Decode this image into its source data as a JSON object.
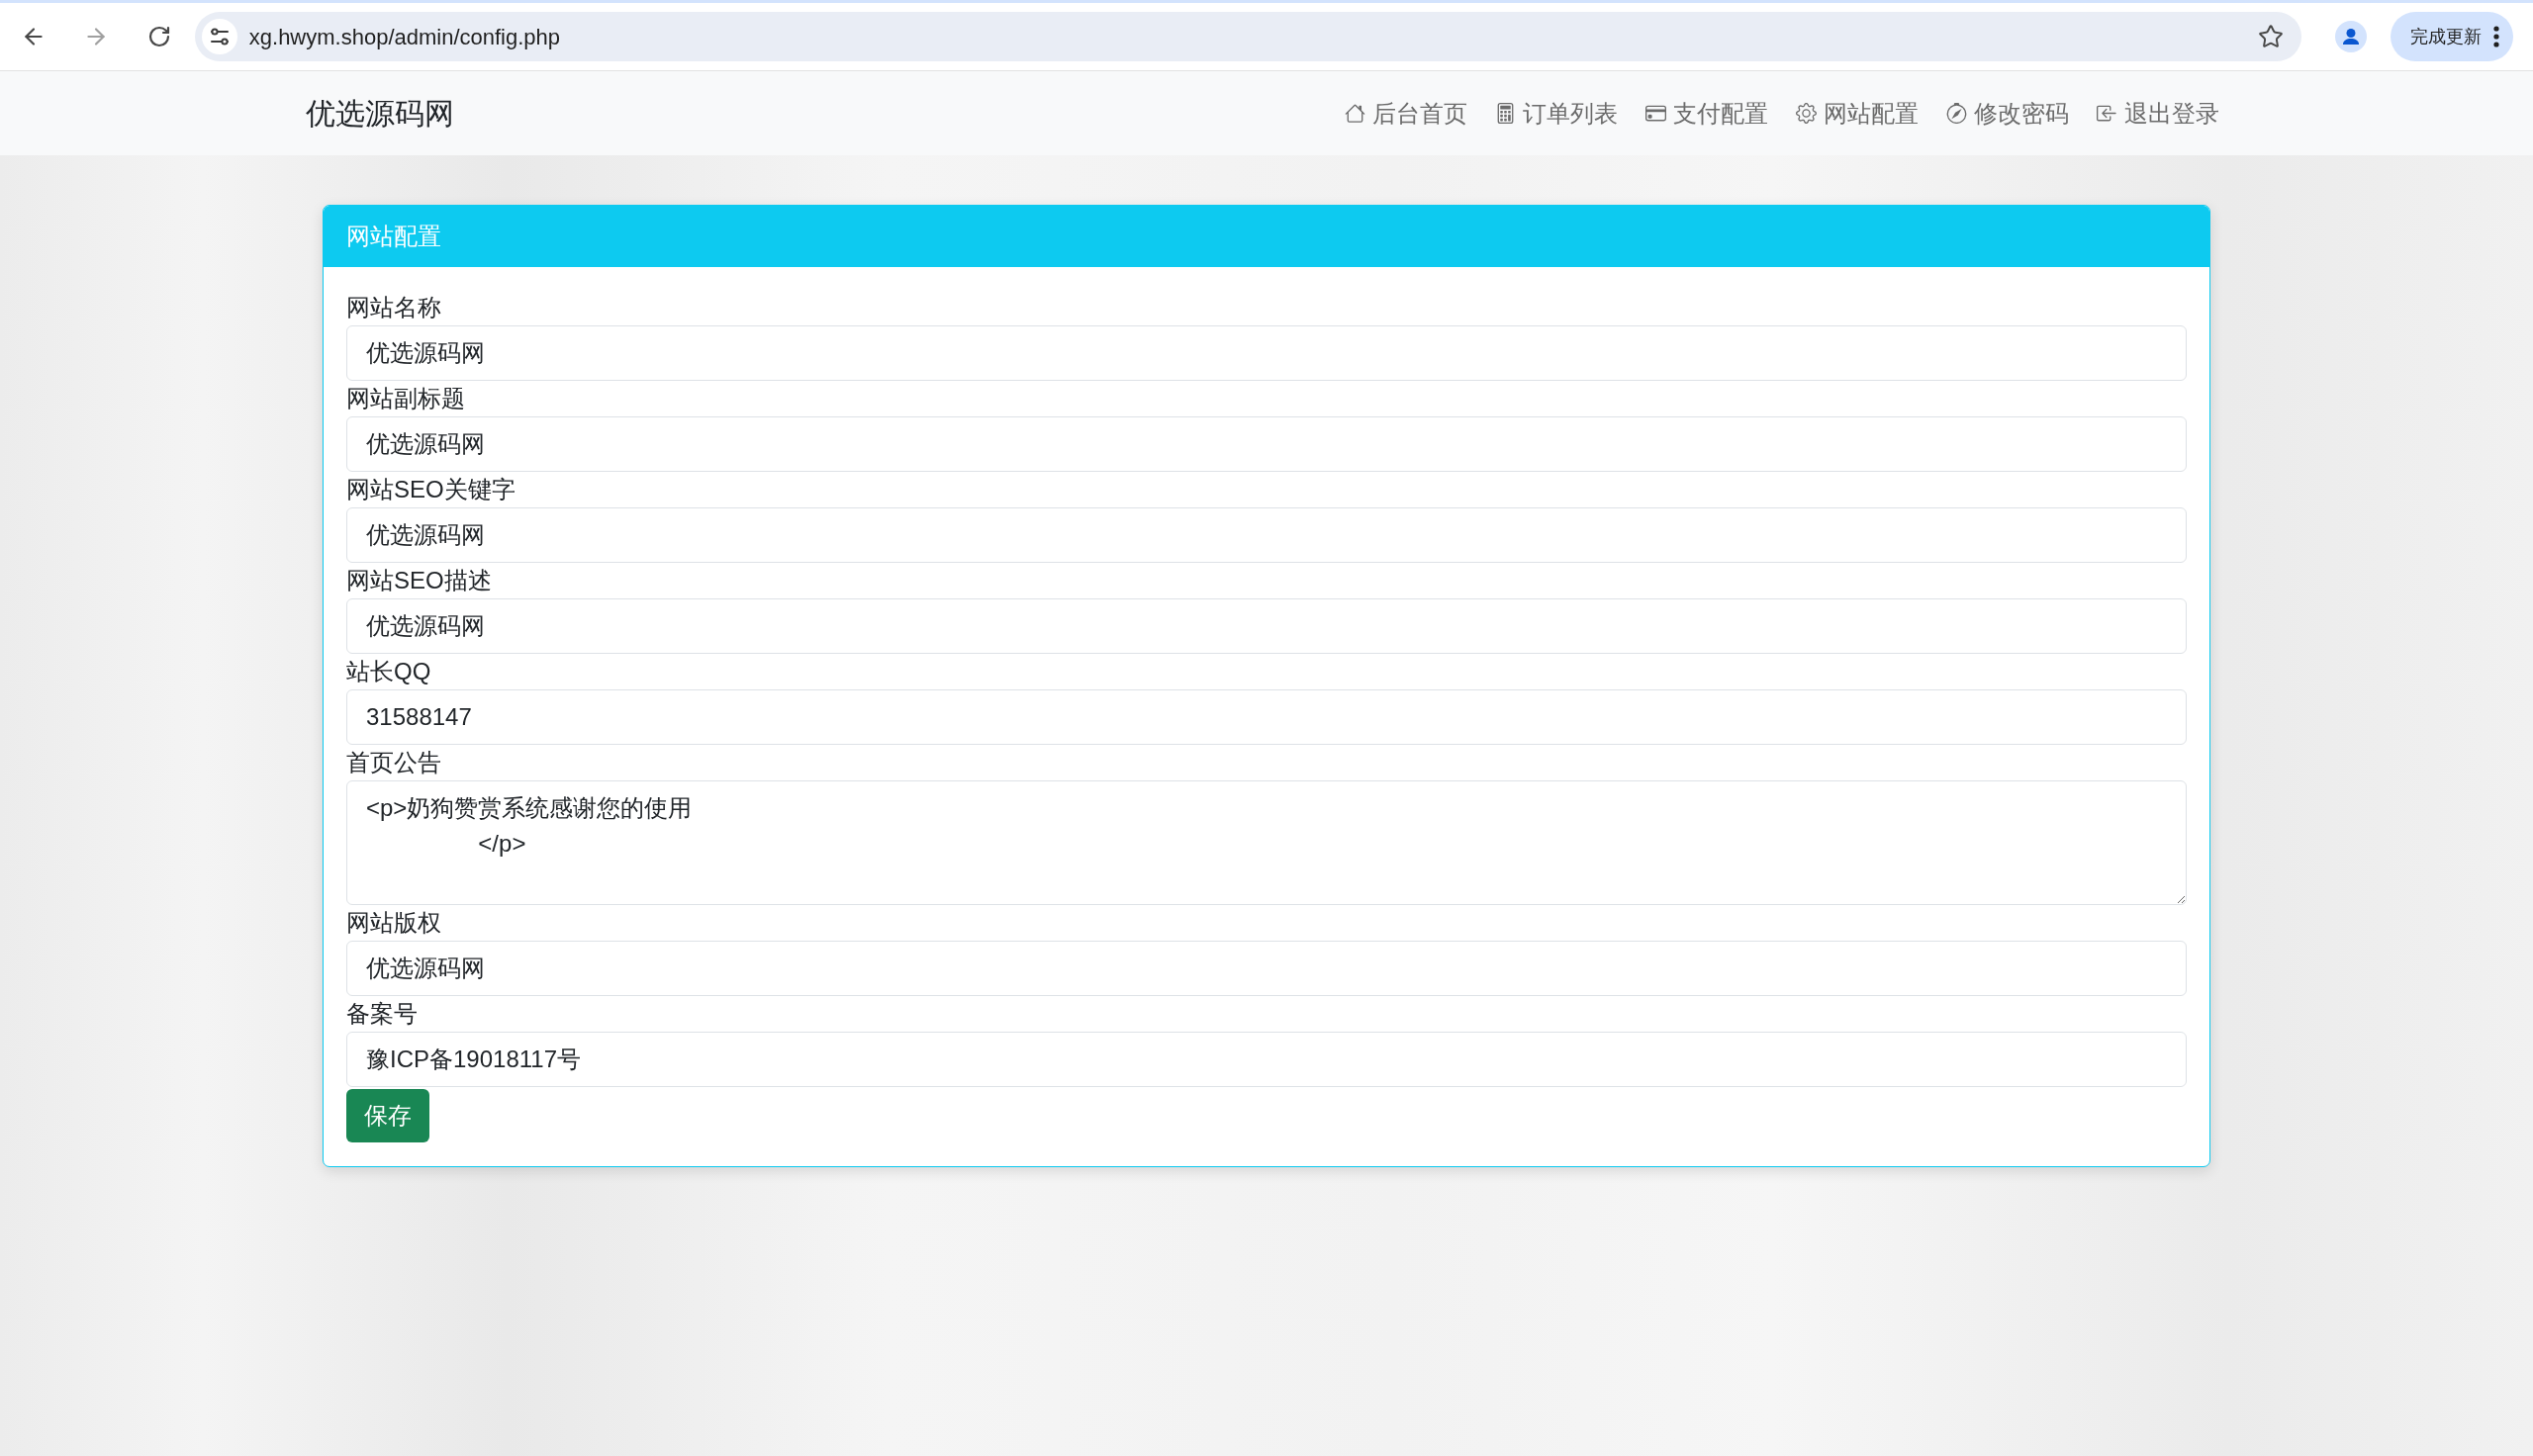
{
  "browser": {
    "url": "xg.hwym.shop/admin/config.php",
    "update_button": "完成更新"
  },
  "navbar": {
    "brand": "优选源码网",
    "items": [
      {
        "label": "后台首页"
      },
      {
        "label": "订单列表"
      },
      {
        "label": "支付配置"
      },
      {
        "label": "网站配置"
      },
      {
        "label": "修改密码"
      },
      {
        "label": "退出登录"
      }
    ]
  },
  "card": {
    "title": "网站配置",
    "fields": [
      {
        "kind": "input",
        "label": "网站名称",
        "value": "优选源码网"
      },
      {
        "kind": "input",
        "label": "网站副标题",
        "value": "优选源码网"
      },
      {
        "kind": "input",
        "label": "网站SEO关键字",
        "value": "优选源码网"
      },
      {
        "kind": "input",
        "label": "网站SEO描述",
        "value": "优选源码网"
      },
      {
        "kind": "input",
        "label": "站长QQ",
        "value": "31588147"
      },
      {
        "kind": "textarea",
        "label": "首页公告",
        "value": "<p>奶狗赞赏系统感谢您的使用\n                 </p>"
      },
      {
        "kind": "input",
        "label": "网站版权",
        "value": "优选源码网"
      },
      {
        "kind": "input",
        "label": "备案号",
        "value": "豫ICP备19018117号"
      }
    ],
    "save_button": "保存"
  }
}
